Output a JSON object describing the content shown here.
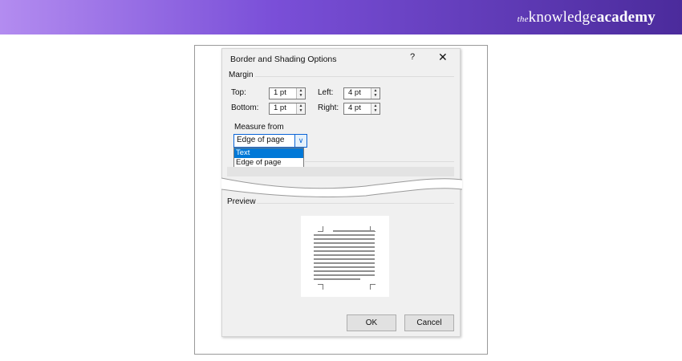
{
  "brand": {
    "prefix": "the",
    "main": "knowledge",
    "bold": "academy"
  },
  "dialog": {
    "title": "Border and Shading Options",
    "help": "?",
    "close": "✕",
    "margin": {
      "group_label": "Margin",
      "top_label": "Top:",
      "top_value": "1 pt",
      "bottom_label": "Bottom:",
      "bottom_value": "1 pt",
      "left_label": "Left:",
      "left_value": "4 pt",
      "right_label": "Right:",
      "right_value": "4 pt"
    },
    "measure_from": {
      "label": "Measure from",
      "selected": "Edge of page",
      "options": [
        "Text",
        "Edge of page"
      ],
      "highlighted": "Text"
    },
    "preview": {
      "group_label": "Preview"
    },
    "buttons": {
      "ok": "OK",
      "cancel": "Cancel"
    }
  }
}
